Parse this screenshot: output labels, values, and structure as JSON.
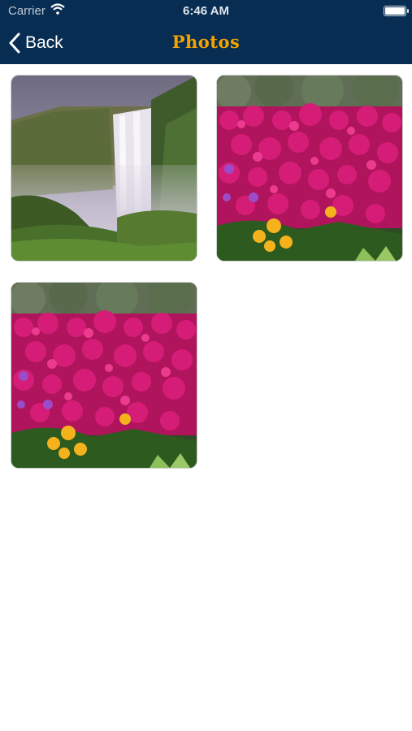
{
  "status_bar": {
    "carrier": "Carrier",
    "time": "6:46 AM"
  },
  "nav": {
    "back_label": "Back",
    "title": "Photos"
  },
  "colors": {
    "header_bg": "#072d52",
    "title": "#f2a300"
  },
  "photos": [
    {
      "subject": "waterfall"
    },
    {
      "subject": "magenta-flowers"
    },
    {
      "subject": "magenta-flowers"
    }
  ]
}
